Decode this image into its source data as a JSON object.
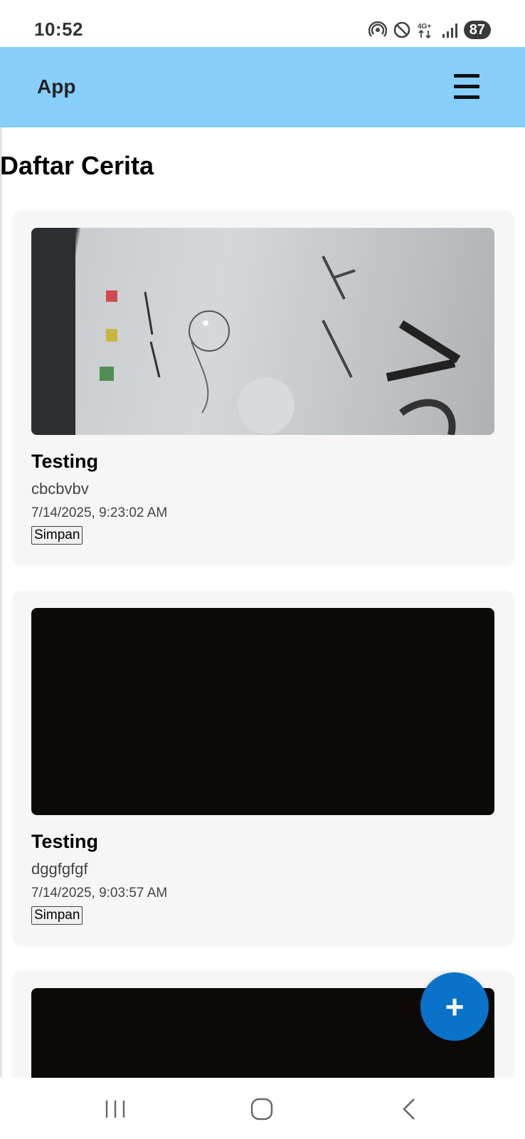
{
  "status_bar": {
    "time": "10:52",
    "battery": "87",
    "network": "4G+",
    "icons": [
      "hotspot-icon",
      "do-not-disturb-icon",
      "network-4g-icon",
      "signal-icon",
      "battery-icon"
    ]
  },
  "app_bar": {
    "title": "App",
    "menu_icon": "hamburger-menu-icon"
  },
  "page": {
    "title": "Daftar Cerita"
  },
  "stories": [
    {
      "name": "Testing",
      "description": "cbcbvbv",
      "date": "7/14/2025, 9:23:02 AM",
      "save_label": "Simpan",
      "image": "photo-handwritten-paper"
    },
    {
      "name": "Testing",
      "description": "dggfgfgf",
      "date": "7/14/2025, 9:03:57 AM",
      "save_label": "Simpan",
      "image": "dark-photo"
    },
    {
      "image": "dark-photo"
    }
  ],
  "fab": {
    "label": "+",
    "icon": "plus-icon"
  },
  "nav_bar": {
    "icons": [
      "recent-apps-icon",
      "home-icon",
      "back-icon"
    ]
  },
  "colors": {
    "app_bar": "#87cefa",
    "fab": "#0a72c9",
    "card": "#f6f6f6"
  }
}
